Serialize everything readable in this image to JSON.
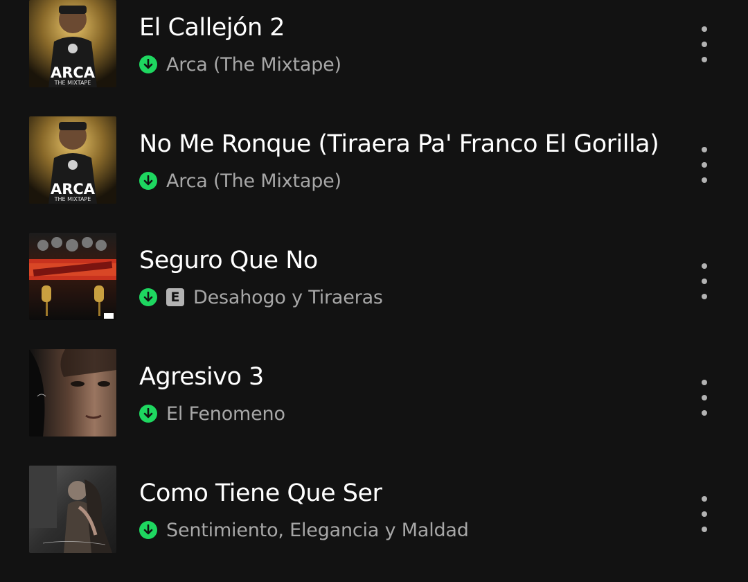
{
  "tracks": [
    {
      "title": "El Callejón 2",
      "album": "Arca (The Mixtape)",
      "explicit": false,
      "cover_lines": [
        "ARCA",
        "THE MIXTAPE"
      ]
    },
    {
      "title": "No Me Ronque (Tiraera Pa' Franco El Gorilla)",
      "album": "Arca (The Mixtape)",
      "explicit": false,
      "cover_lines": [
        "ARCA",
        "THE MIXTAPE"
      ]
    },
    {
      "title": "Seguro Que No",
      "album": "Desahogo y Tiraeras",
      "explicit": true,
      "explicit_label": "E"
    },
    {
      "title": "Agresivo 3",
      "album": "El Fenomeno",
      "explicit": false
    },
    {
      "title": "Como Tiene Que Ser",
      "album": "Sentimiento, Elegancia y Maldad",
      "explicit": false
    }
  ],
  "colors": {
    "background": "#121212",
    "title": "#ffffff",
    "subtitle": "#a7a7a7",
    "download": "#1ed760",
    "icon_gray": "#b3b3b3"
  },
  "icons": {
    "download": "download-arrow-icon",
    "more": "more-vertical-icon"
  }
}
